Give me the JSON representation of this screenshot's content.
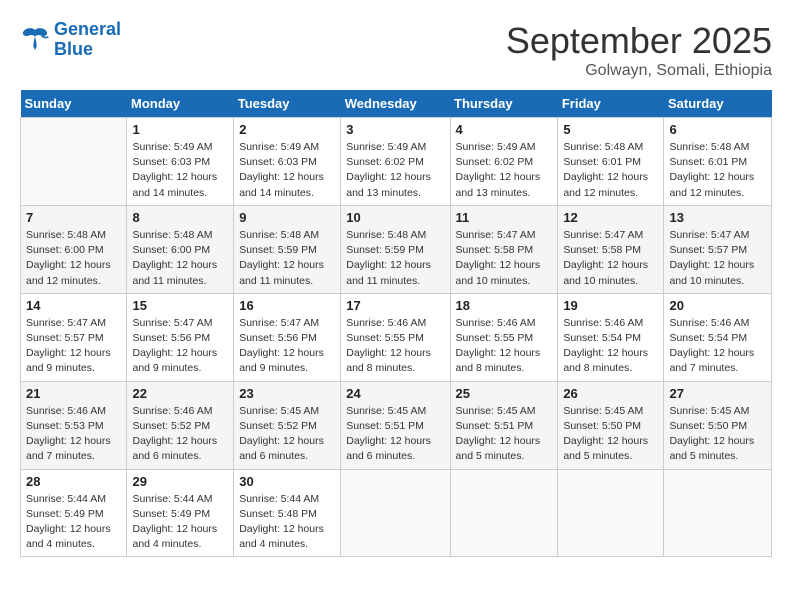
{
  "logo": {
    "line1": "General",
    "line2": "Blue"
  },
  "title": "September 2025",
  "subtitle": "Golwayn, Somali, Ethiopia",
  "days_of_week": [
    "Sunday",
    "Monday",
    "Tuesday",
    "Wednesday",
    "Thursday",
    "Friday",
    "Saturday"
  ],
  "weeks": [
    [
      {
        "day": "",
        "info": ""
      },
      {
        "day": "1",
        "info": "Sunrise: 5:49 AM\nSunset: 6:03 PM\nDaylight: 12 hours\nand 14 minutes."
      },
      {
        "day": "2",
        "info": "Sunrise: 5:49 AM\nSunset: 6:03 PM\nDaylight: 12 hours\nand 14 minutes."
      },
      {
        "day": "3",
        "info": "Sunrise: 5:49 AM\nSunset: 6:02 PM\nDaylight: 12 hours\nand 13 minutes."
      },
      {
        "day": "4",
        "info": "Sunrise: 5:49 AM\nSunset: 6:02 PM\nDaylight: 12 hours\nand 13 minutes."
      },
      {
        "day": "5",
        "info": "Sunrise: 5:48 AM\nSunset: 6:01 PM\nDaylight: 12 hours\nand 12 minutes."
      },
      {
        "day": "6",
        "info": "Sunrise: 5:48 AM\nSunset: 6:01 PM\nDaylight: 12 hours\nand 12 minutes."
      }
    ],
    [
      {
        "day": "7",
        "info": "Sunrise: 5:48 AM\nSunset: 6:00 PM\nDaylight: 12 hours\nand 12 minutes."
      },
      {
        "day": "8",
        "info": "Sunrise: 5:48 AM\nSunset: 6:00 PM\nDaylight: 12 hours\nand 11 minutes."
      },
      {
        "day": "9",
        "info": "Sunrise: 5:48 AM\nSunset: 5:59 PM\nDaylight: 12 hours\nand 11 minutes."
      },
      {
        "day": "10",
        "info": "Sunrise: 5:48 AM\nSunset: 5:59 PM\nDaylight: 12 hours\nand 11 minutes."
      },
      {
        "day": "11",
        "info": "Sunrise: 5:47 AM\nSunset: 5:58 PM\nDaylight: 12 hours\nand 10 minutes."
      },
      {
        "day": "12",
        "info": "Sunrise: 5:47 AM\nSunset: 5:58 PM\nDaylight: 12 hours\nand 10 minutes."
      },
      {
        "day": "13",
        "info": "Sunrise: 5:47 AM\nSunset: 5:57 PM\nDaylight: 12 hours\nand 10 minutes."
      }
    ],
    [
      {
        "day": "14",
        "info": "Sunrise: 5:47 AM\nSunset: 5:57 PM\nDaylight: 12 hours\nand 9 minutes."
      },
      {
        "day": "15",
        "info": "Sunrise: 5:47 AM\nSunset: 5:56 PM\nDaylight: 12 hours\nand 9 minutes."
      },
      {
        "day": "16",
        "info": "Sunrise: 5:47 AM\nSunset: 5:56 PM\nDaylight: 12 hours\nand 9 minutes."
      },
      {
        "day": "17",
        "info": "Sunrise: 5:46 AM\nSunset: 5:55 PM\nDaylight: 12 hours\nand 8 minutes."
      },
      {
        "day": "18",
        "info": "Sunrise: 5:46 AM\nSunset: 5:55 PM\nDaylight: 12 hours\nand 8 minutes."
      },
      {
        "day": "19",
        "info": "Sunrise: 5:46 AM\nSunset: 5:54 PM\nDaylight: 12 hours\nand 8 minutes."
      },
      {
        "day": "20",
        "info": "Sunrise: 5:46 AM\nSunset: 5:54 PM\nDaylight: 12 hours\nand 7 minutes."
      }
    ],
    [
      {
        "day": "21",
        "info": "Sunrise: 5:46 AM\nSunset: 5:53 PM\nDaylight: 12 hours\nand 7 minutes."
      },
      {
        "day": "22",
        "info": "Sunrise: 5:46 AM\nSunset: 5:52 PM\nDaylight: 12 hours\nand 6 minutes."
      },
      {
        "day": "23",
        "info": "Sunrise: 5:45 AM\nSunset: 5:52 PM\nDaylight: 12 hours\nand 6 minutes."
      },
      {
        "day": "24",
        "info": "Sunrise: 5:45 AM\nSunset: 5:51 PM\nDaylight: 12 hours\nand 6 minutes."
      },
      {
        "day": "25",
        "info": "Sunrise: 5:45 AM\nSunset: 5:51 PM\nDaylight: 12 hours\nand 5 minutes."
      },
      {
        "day": "26",
        "info": "Sunrise: 5:45 AM\nSunset: 5:50 PM\nDaylight: 12 hours\nand 5 minutes."
      },
      {
        "day": "27",
        "info": "Sunrise: 5:45 AM\nSunset: 5:50 PM\nDaylight: 12 hours\nand 5 minutes."
      }
    ],
    [
      {
        "day": "28",
        "info": "Sunrise: 5:44 AM\nSunset: 5:49 PM\nDaylight: 12 hours\nand 4 minutes."
      },
      {
        "day": "29",
        "info": "Sunrise: 5:44 AM\nSunset: 5:49 PM\nDaylight: 12 hours\nand 4 minutes."
      },
      {
        "day": "30",
        "info": "Sunrise: 5:44 AM\nSunset: 5:48 PM\nDaylight: 12 hours\nand 4 minutes."
      },
      {
        "day": "",
        "info": ""
      },
      {
        "day": "",
        "info": ""
      },
      {
        "day": "",
        "info": ""
      },
      {
        "day": "",
        "info": ""
      }
    ]
  ]
}
